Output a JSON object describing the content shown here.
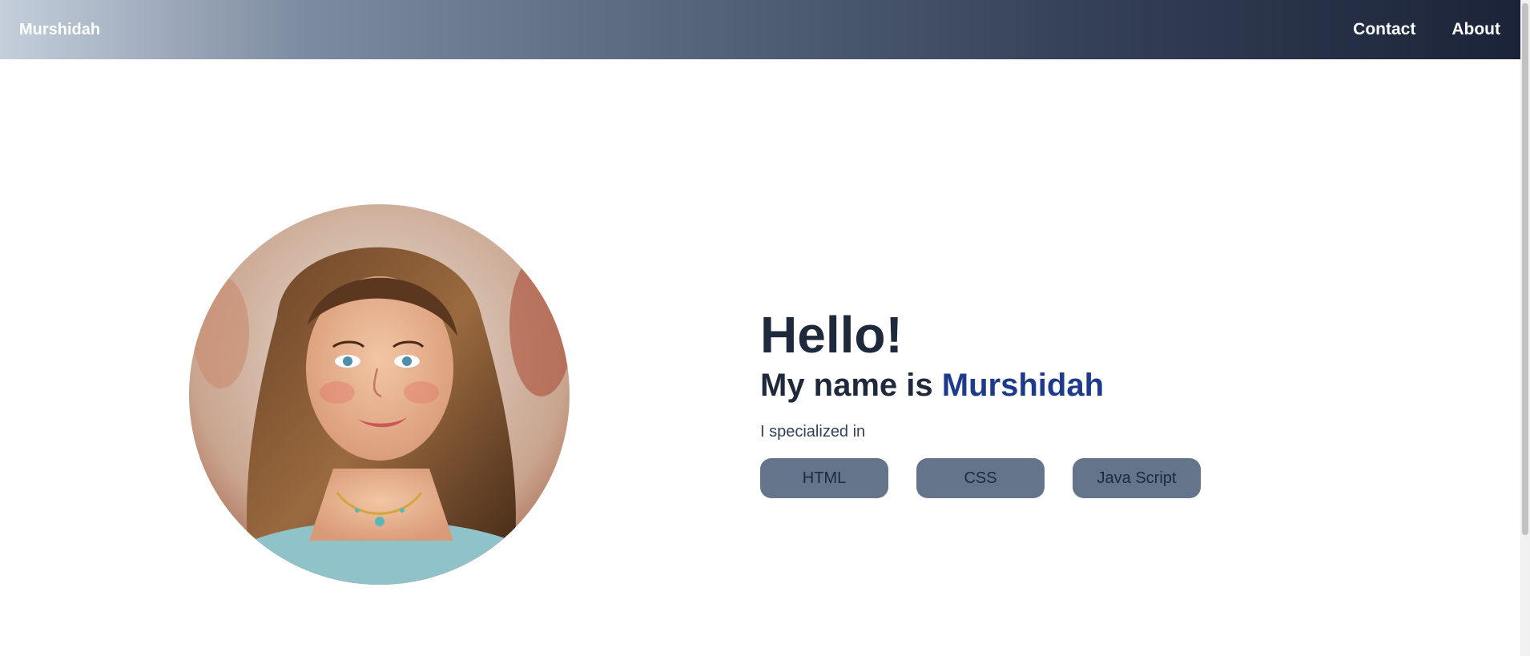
{
  "navbar": {
    "brand": "Murshidah",
    "links": [
      {
        "label": "Contact"
      },
      {
        "label": "About"
      }
    ]
  },
  "hero": {
    "greeting": "Hello!",
    "name_prefix": "My name is",
    "name": "Murshidah",
    "specialized_label": "I specialized in",
    "skills": [
      {
        "label": "HTML"
      },
      {
        "label": "CSS"
      },
      {
        "label": "Java Script"
      }
    ]
  },
  "colors": {
    "heading": "#1e293b",
    "name_accent": "#1e3a8a",
    "skill_button": "#64748b"
  }
}
